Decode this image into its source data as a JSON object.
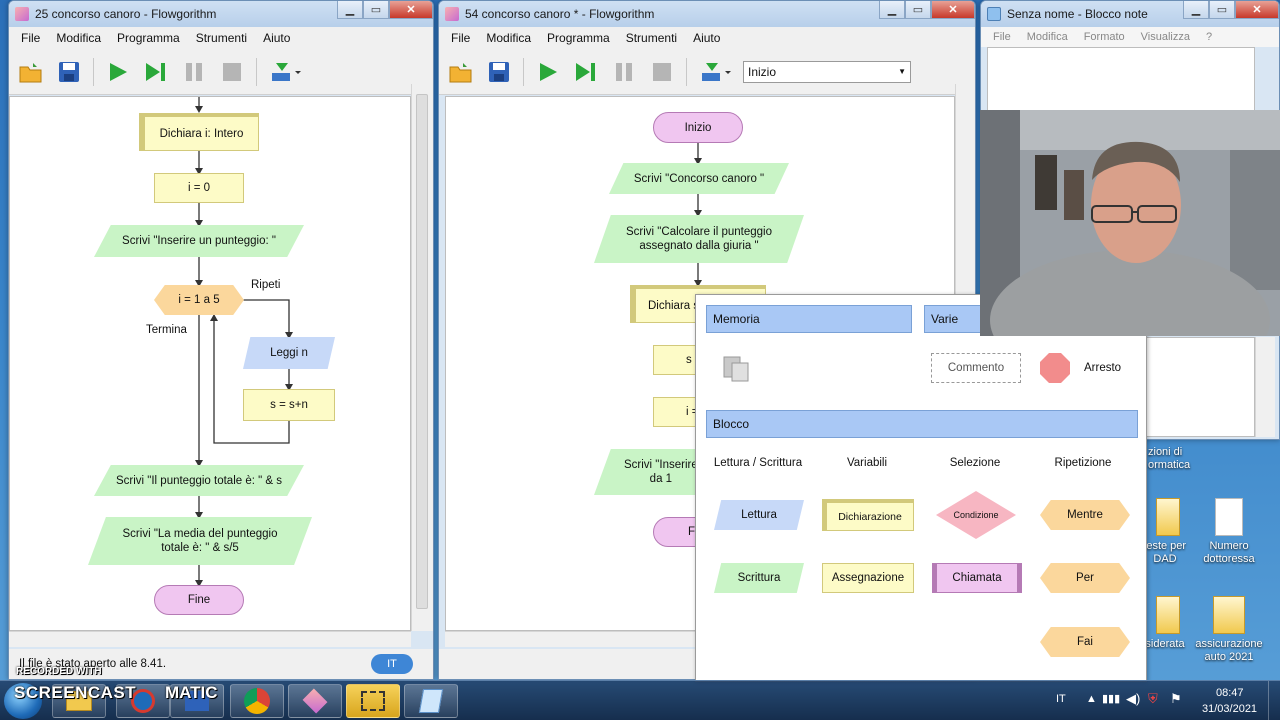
{
  "colors": {
    "terminal": "#f0c6f0",
    "declare": "#fdfbc7",
    "output": "#c9f4c6",
    "input": "#c7d9f8",
    "loop": "#fbd79c",
    "call": "#f0c6f0",
    "stop": "#f28c8c",
    "decision": "#f7b6c2"
  },
  "win1": {
    "title": "25 concorso canoro - Flowgorithm",
    "menu": [
      "File",
      "Modifica",
      "Programma",
      "Strumenti",
      "Aiuto"
    ],
    "flow": {
      "declare": "Dichiara i: Intero",
      "assign_i": "i = 0",
      "write_prompt": "Scrivi \"Inserire un punteggio: \"",
      "loop": "i = 1 a 5",
      "loop_repeat": "Ripeti",
      "loop_end": "Termina",
      "read": "Leggi n",
      "assign_s": "s = s+n",
      "write_total": "Scrivi \"Il punteggio totale è: \" & s",
      "write_avg_1": "Scrivi \"La media del punteggio",
      "write_avg_2": "totale è: \" & s/5",
      "end": "Fine"
    },
    "status": "Il file è stato aperto alle 8.41.",
    "lang": "IT"
  },
  "win2": {
    "title": "54 concorso canoro * - Flowgorithm",
    "menu": [
      "File",
      "Modifica",
      "Programma",
      "Strumenti",
      "Aiuto"
    ],
    "dropdown_value": "Inizio",
    "flow": {
      "start": "Inizio",
      "write1": "Scrivi \"Concorso canoro \"",
      "write2_1": "Scrivi \"Calcolare il punteggio",
      "write2_2": "assegnato dalla giuria \"",
      "declare_partial": "Dichiara s",
      "assign_partial1": "s =",
      "assign_partial2": "i =",
      "write3_1": "Scrivi \"Inserire",
      "write3_2": "da 1",
      "end_partial": "Fi"
    }
  },
  "palette": {
    "memoria": "Memoria",
    "varie": "Varie",
    "commento": "Commento",
    "arresto": "Arresto",
    "blocco": "Blocco",
    "col_io": "Lettura / Scrittura",
    "col_var": "Variabili",
    "col_sel": "Selezione",
    "col_rep": "Ripetizione",
    "lettura": "Lettura",
    "dichiarazione": "Dichiarazione",
    "condizione": "Condizione",
    "mentre": "Mentre",
    "scrittura": "Scrittura",
    "assegnazione": "Assegnazione",
    "chiamata": "Chiamata",
    "per": "Per",
    "fai": "Fai"
  },
  "notepad": {
    "title": "Senza nome - Blocco note",
    "menu": [
      "File",
      "Modifica",
      "Formato",
      "Visualizza",
      "?"
    ]
  },
  "desktop": {
    "partial_text_1": "zioni di",
    "partial_text_2": "ormatica",
    "icons": [
      {
        "line1": "ieste per",
        "line2": "DAD"
      },
      {
        "line1": "Numero",
        "line2": "dottoressa"
      },
      {
        "line1": "siderata",
        "line2": ""
      },
      {
        "line1": "assicurazione",
        "line2": "auto 2021"
      }
    ]
  },
  "taskbar": {
    "lang": "IT",
    "time": "08:47",
    "date": "31/03/2021"
  },
  "watermark": {
    "recorded": "RECORDED WITH",
    "brand_left": "SCREENCAST",
    "brand_right": "MATIC"
  }
}
